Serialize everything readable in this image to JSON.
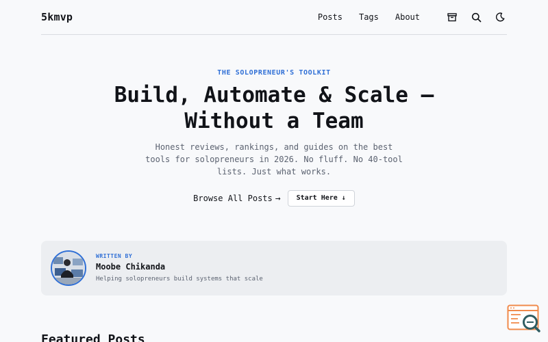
{
  "header": {
    "logo": "5kmvp",
    "nav": [
      {
        "label": "Posts"
      },
      {
        "label": "Tags"
      },
      {
        "label": "About"
      }
    ],
    "icons": [
      "archive-icon",
      "search-icon",
      "moon-icon"
    ]
  },
  "hero": {
    "kicker": "THE SOLOPRENEUR'S TOOLKIT",
    "title_line1": "Build, Automate & Scale —",
    "title_line2": "Without a Team",
    "subtitle": "Honest reviews, rankings, and guides on the best tools for solopreneurs in 2026. No fluff. No 40-tool lists. Just what works.",
    "browse_label": "Browse All Posts",
    "browse_arrow": "→",
    "start_label": "Start Here ↓"
  },
  "author": {
    "written_by": "WRITTEN BY",
    "name": "Moobe Chikanda",
    "tagline": "Helping solopreneurs build systems that scale"
  },
  "featured": {
    "title": "Featured Posts"
  },
  "colors": {
    "accent": "#2f6fd6",
    "widget_orange": "#f08a4b",
    "widget_teal": "#2f5d62"
  }
}
